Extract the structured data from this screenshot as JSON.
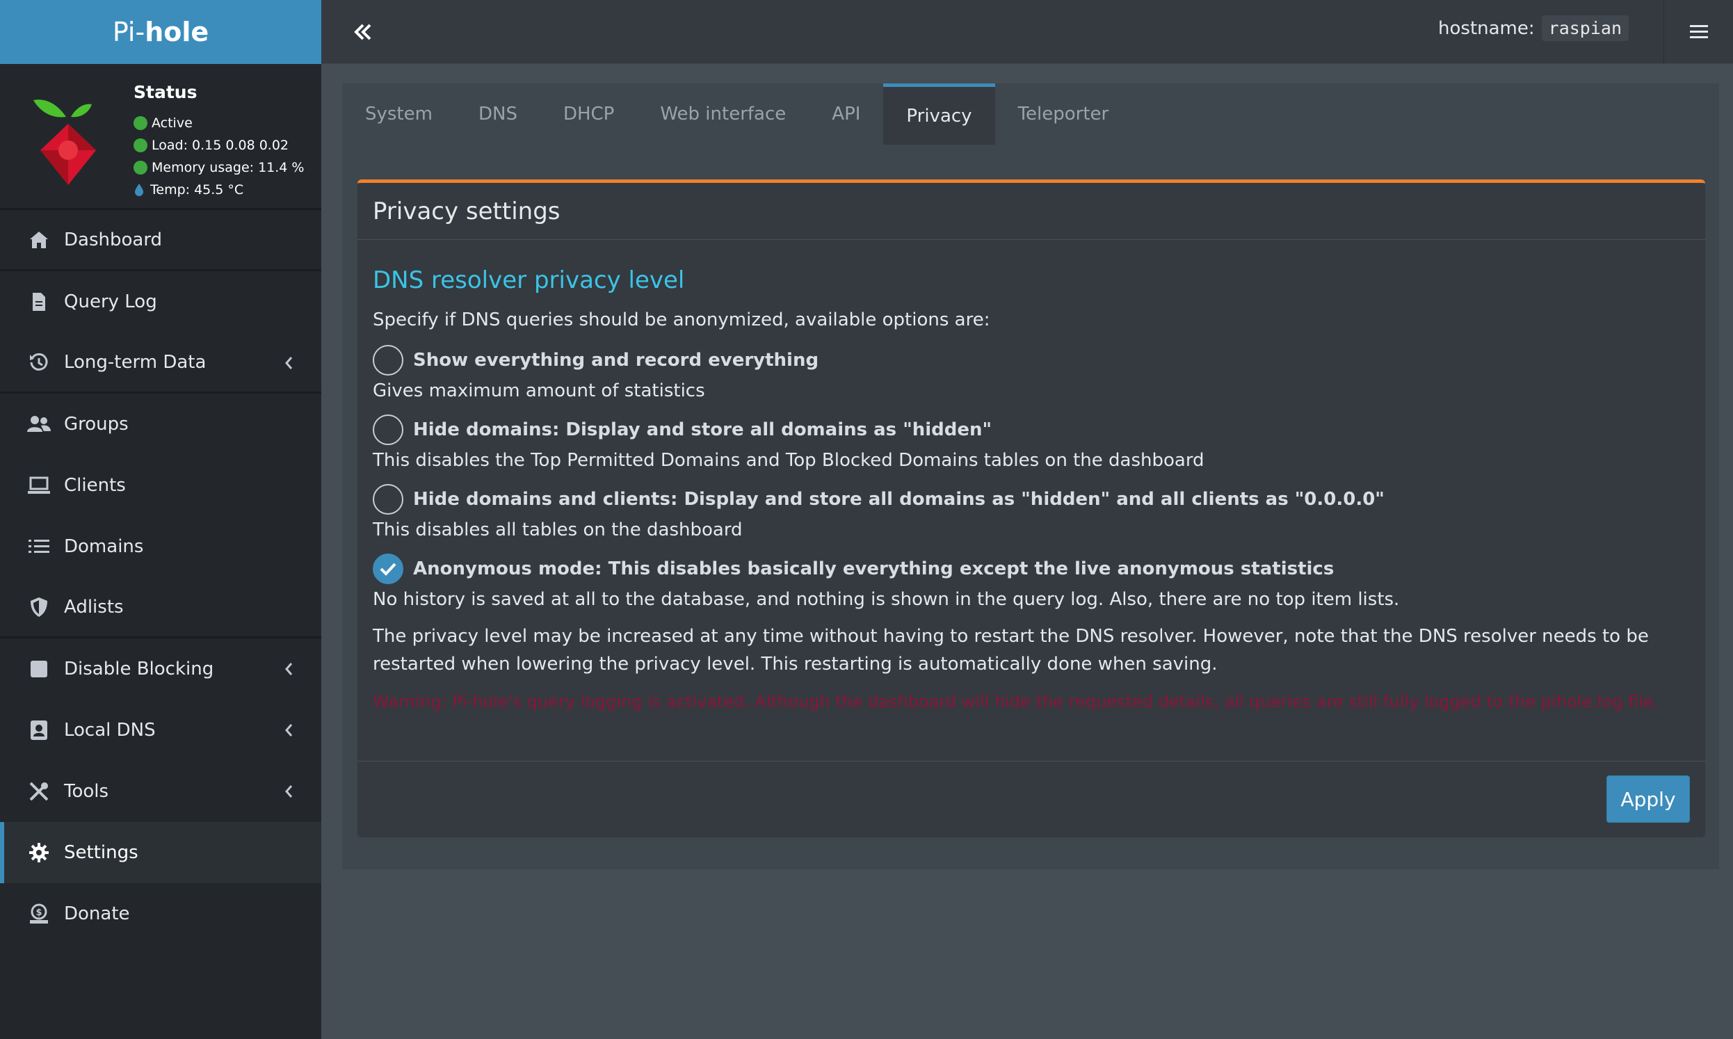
{
  "brand": {
    "prefix": "Pi-",
    "name": "hole"
  },
  "status": {
    "title": "Status",
    "active": "Active",
    "load": "Load:  0.15  0.08  0.02",
    "memory": "Memory usage:  11.4 %",
    "temp": "Temp: 45.5 °C"
  },
  "sidebar": {
    "items": [
      {
        "label": "Dashboard",
        "icon": "home-icon"
      },
      {
        "label": "Query Log",
        "icon": "file-icon"
      },
      {
        "label": "Long-term Data",
        "icon": "history-icon"
      },
      {
        "label": "Groups",
        "icon": "users-icon"
      },
      {
        "label": "Clients",
        "icon": "laptop-icon"
      },
      {
        "label": "Domains",
        "icon": "list-icon"
      },
      {
        "label": "Adlists",
        "icon": "shield-icon"
      },
      {
        "label": "Disable Blocking",
        "icon": "stop-icon"
      },
      {
        "label": "Local DNS",
        "icon": "address-book-icon"
      },
      {
        "label": "Tools",
        "icon": "tools-icon"
      },
      {
        "label": "Settings",
        "icon": "gear-icon"
      },
      {
        "label": "Donate",
        "icon": "donate-icon"
      }
    ]
  },
  "topbar": {
    "hostname_label": "hostname:",
    "hostname_value": "raspian"
  },
  "tabs": [
    "System",
    "DNS",
    "DHCP",
    "Web interface",
    "API",
    "Privacy",
    "Teleporter"
  ],
  "active_tab": "Privacy",
  "card": {
    "title": "Privacy settings",
    "section_title": "DNS resolver privacy level",
    "intro": "Specify if DNS queries should be anonymized, available options are:",
    "options": [
      {
        "label": "Show everything and record everything",
        "desc": "Gives maximum amount of statistics",
        "checked": false
      },
      {
        "label": "Hide domains: Display and store all domains as \"hidden\"",
        "desc": "This disables the Top Permitted Domains and Top Blocked Domains tables on the dashboard",
        "checked": false
      },
      {
        "label": "Hide domains and clients: Display and store all domains as \"hidden\" and all clients as \"0.0.0.0\"",
        "desc": "This disables all tables on the dashboard",
        "checked": false
      },
      {
        "label": "Anonymous mode: This disables basically everything except the live anonymous statistics",
        "desc": "No history is saved at all to the database, and nothing is shown in the query log. Also, there are no top item lists.",
        "checked": true
      }
    ],
    "note": "The privacy level may be increased at any time without having to restart the DNS resolver. However, note that the DNS resolver needs to be restarted when lowering the privacy level. This restarting is automatically done when saving.",
    "warning": "Warning: Pi-hole's query logging is activated. Although the dashboard will hide the requested details, all queries are still fully logged to the pihole.log file.",
    "apply_label": "Apply"
  },
  "colors": {
    "accent": "#3c8dbc",
    "card_border": "#f0812c",
    "section_title": "#3bc4e6",
    "warning": "#8a1538"
  }
}
